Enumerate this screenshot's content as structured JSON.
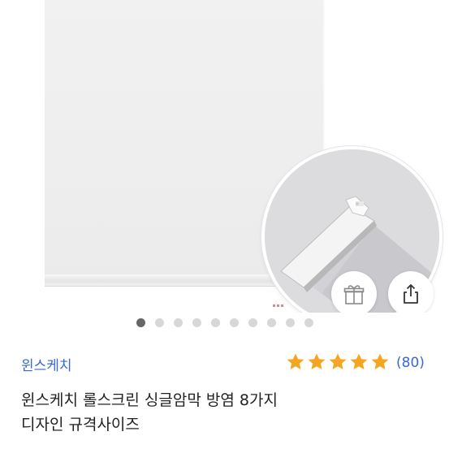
{
  "product": {
    "brand": "윈스케치",
    "title_line1": "윈스케치 롤스크린 싱글암막 방염 8가지",
    "title_line2": "디자인 규격사이즈",
    "review_count": "(80)",
    "rating_stars": 5
  },
  "carousel": {
    "total_slides": 10,
    "active_index": 0
  },
  "icons": {
    "gift": "gift-icon",
    "share": "share-icon",
    "star": "star-icon"
  },
  "colors": {
    "accent": "#3769cf",
    "star": "#f4a623",
    "active_dot": "#666666",
    "inactive_dot": "#d7d7d7"
  }
}
